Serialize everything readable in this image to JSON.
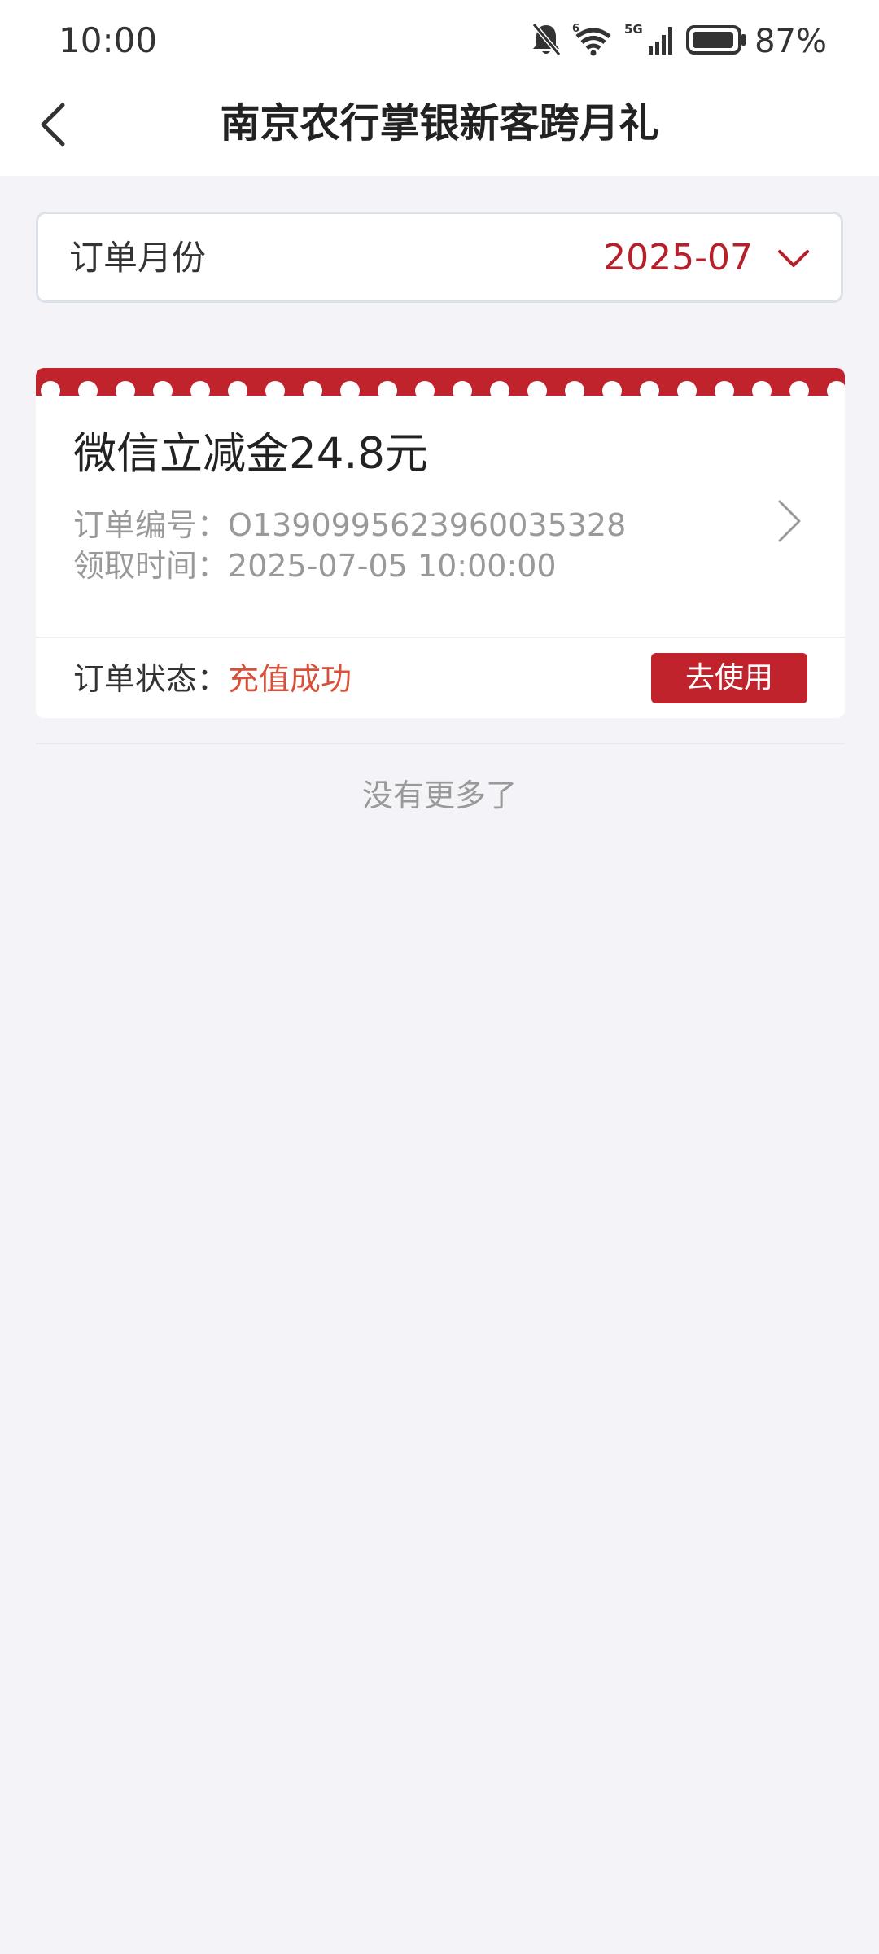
{
  "status_bar": {
    "time": "10:00",
    "battery": "87%",
    "icons": [
      "bell-muted-icon",
      "wifi-icon",
      "signal-5g-icon",
      "battery-icon"
    ]
  },
  "nav": {
    "title": "南京农行掌银新客跨月礼"
  },
  "filter": {
    "label": "订单月份",
    "value": "2025-07"
  },
  "order": {
    "title": "微信立减金24.8元",
    "order_no_label": "订单编号：",
    "order_no": "O1390995623960035328",
    "time_label": "领取时间：",
    "time": "2025-07-05 10:00:00",
    "status_label": "订单状态：",
    "status": "充值成功",
    "action_label": "去使用"
  },
  "footer": {
    "no_more": "没有更多了"
  },
  "colors": {
    "accent": "#c0232b",
    "status_success": "#d9503a",
    "background": "#f3f3f8"
  }
}
